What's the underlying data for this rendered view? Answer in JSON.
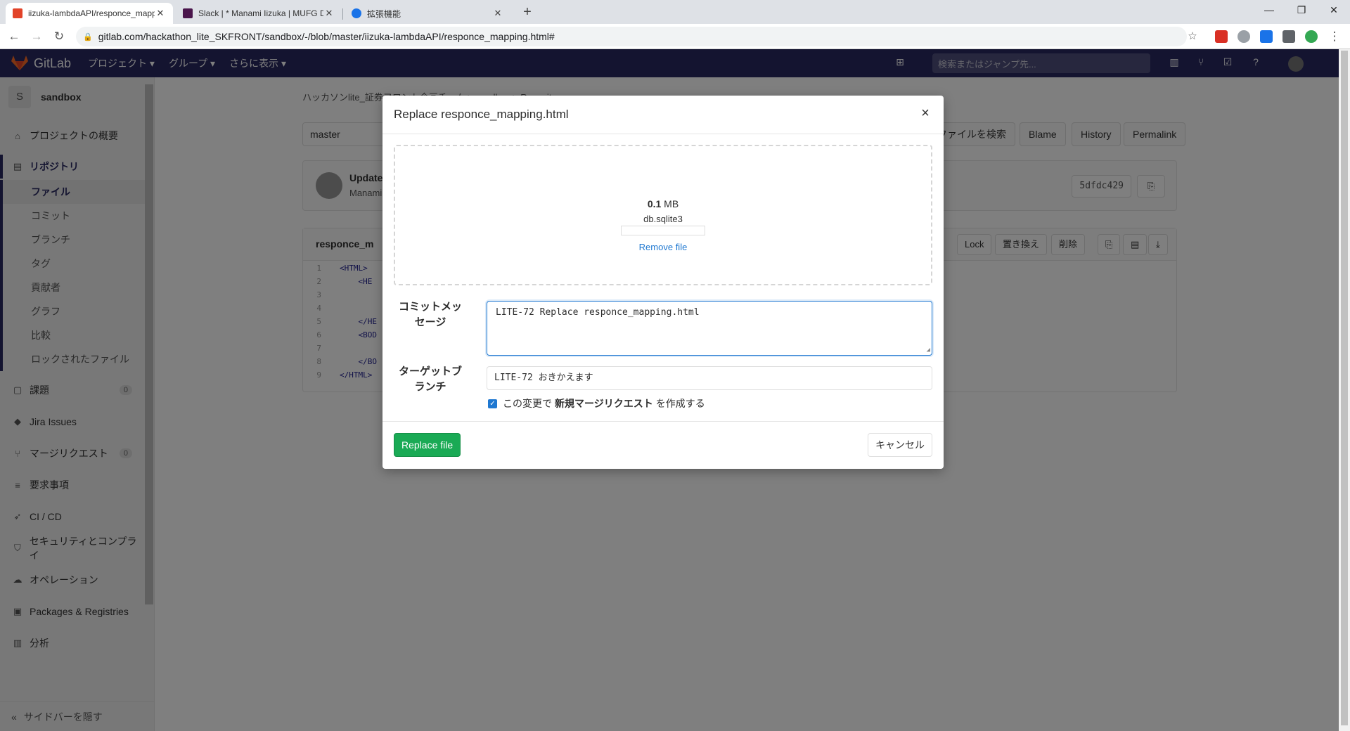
{
  "browser": {
    "tabs": [
      {
        "title": "iizuka-lambdaAPI/responce_mapping",
        "active": true
      },
      {
        "title": "Slack | * Manami Iizuka | MUFG D",
        "active": false
      },
      {
        "title": "拡張機能",
        "active": false
      }
    ],
    "url": "gitlab.com/hackathon_lite_SKFRONT/sandbox/-/blob/master/iizuka-lambdaAPI/responce_mapping.html#"
  },
  "gitlab_header": {
    "logo": "GitLab",
    "nav": [
      "プロジェクト",
      "グループ",
      "さらに表示"
    ],
    "search_placeholder": "検索またはジャンプ先..."
  },
  "sidebar": {
    "project_initial": "S",
    "project_name": "sandbox",
    "items": [
      {
        "label": "プロジェクトの概要",
        "icon": "home-icon"
      },
      {
        "label": "リポジトリ",
        "icon": "doc-icon"
      },
      {
        "label": "課題",
        "icon": "issues-icon",
        "count": "0"
      },
      {
        "label": "Jira Issues",
        "icon": "jira-icon"
      },
      {
        "label": "マージリクエスト",
        "icon": "merge-icon",
        "count": "0"
      },
      {
        "label": "要求事項",
        "icon": "requirements-icon"
      },
      {
        "label": "CI / CD",
        "icon": "rocket-icon"
      },
      {
        "label": "セキュリティとコンプライ",
        "icon": "shield-icon"
      },
      {
        "label": "オペレーション",
        "icon": "cloud-icon"
      },
      {
        "label": "Packages & Registries",
        "icon": "package-icon"
      },
      {
        "label": "分析",
        "icon": "chart-icon"
      }
    ],
    "repo_sub": [
      "ファイル",
      "コミット",
      "ブランチ",
      "タグ",
      "貢献者",
      "グラフ",
      "比較",
      "ロックされたファイル"
    ],
    "collapse_label": "サイドバーを隠す"
  },
  "main": {
    "breadcrumb": "ハッカソンlite_証券フロント企画チーム > sandbox > Repository",
    "branch": "master",
    "buttons": [
      "ファイルを検索",
      "Blame",
      "History",
      "Permalink"
    ],
    "commit_title": "Update",
    "commit_author": "Manami",
    "commit_sha": "5dfdc429",
    "file_name": "responce_m",
    "file_buttons": [
      "Lock",
      "置き換え",
      "削除"
    ],
    "code_lines": [
      {
        "n": "1",
        "t": "<HTML>"
      },
      {
        "n": "2",
        "t": "    <HE"
      },
      {
        "n": "3",
        "t": ""
      },
      {
        "n": "4",
        "t": ""
      },
      {
        "n": "5",
        "t": "    </HE"
      },
      {
        "n": "6",
        "t": "    <BOD"
      },
      {
        "n": "7",
        "t": ""
      },
      {
        "n": "8",
        "t": "    </BO"
      },
      {
        "n": "9",
        "t": "</HTML>"
      }
    ]
  },
  "modal": {
    "title": "Replace responce_mapping.html",
    "file_size_value": "0.1",
    "file_size_unit": " MB",
    "file_name": "db.sqlite3",
    "upload_progress": 0,
    "remove_label": "Remove file",
    "commit_label": "コミットメッセージ",
    "commit_message": "LITE-72 Replace responce_mapping.html",
    "target_label": "ターゲットブランチ",
    "target_branch": "LITE-72 おきかえます",
    "mr_checkbox_pre": "この変更で",
    "mr_checkbox_bold": "新規マージリクエスト",
    "mr_checkbox_post": "を作成する",
    "mr_checked": true,
    "submit_label": "Replace file",
    "cancel_label": "キャンセル"
  },
  "colors": {
    "header_bg": "#292961",
    "success": "#1aaa55",
    "link": "#1f78d1"
  }
}
